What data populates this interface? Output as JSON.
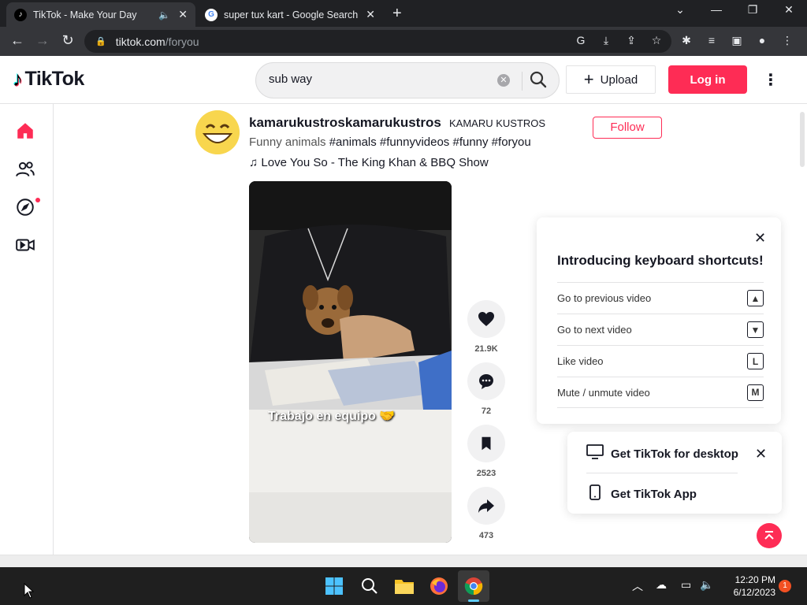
{
  "browser": {
    "tabs": [
      {
        "title": "TikTok - Make Your Day",
        "active": true
      },
      {
        "title": "super tux kart - Google Search",
        "active": false
      }
    ],
    "url_domain": "tiktok.com",
    "url_path": "/foryou"
  },
  "header": {
    "logo": "TikTok",
    "search_value": "sub way",
    "upload_label": "Upload",
    "login_label": "Log in"
  },
  "post": {
    "username": "kamarukustroskamarukustros",
    "nickname": "KAMARU KUSTROS",
    "caption_text": "Funny animals",
    "hashtags": "#animals #funnyvideos #funny #foryou",
    "music": "Love You So - The King Khan & BBQ Show",
    "follow_label": "Follow",
    "video_caption": "Trabajo en equipo 🤝",
    "likes": "21.9K",
    "comments": "72",
    "saves": "2523",
    "shares": "473"
  },
  "shortcuts": {
    "title": "Introducing keyboard shortcuts!",
    "items": [
      {
        "label": "Go to previous video",
        "key": "▲"
      },
      {
        "label": "Go to next video",
        "key": "▼"
      },
      {
        "label": "Like video",
        "key": "L"
      },
      {
        "label": "Mute / unmute video",
        "key": "M"
      }
    ]
  },
  "get_app": {
    "desktop_label": "Get TikTok for desktop",
    "app_label": "Get TikTok App"
  },
  "taskbar": {
    "time": "12:20 PM",
    "date": "6/12/2023",
    "notifications": "1"
  },
  "colors": {
    "brand": "#fe2c55",
    "chrome_dark": "#202124"
  }
}
